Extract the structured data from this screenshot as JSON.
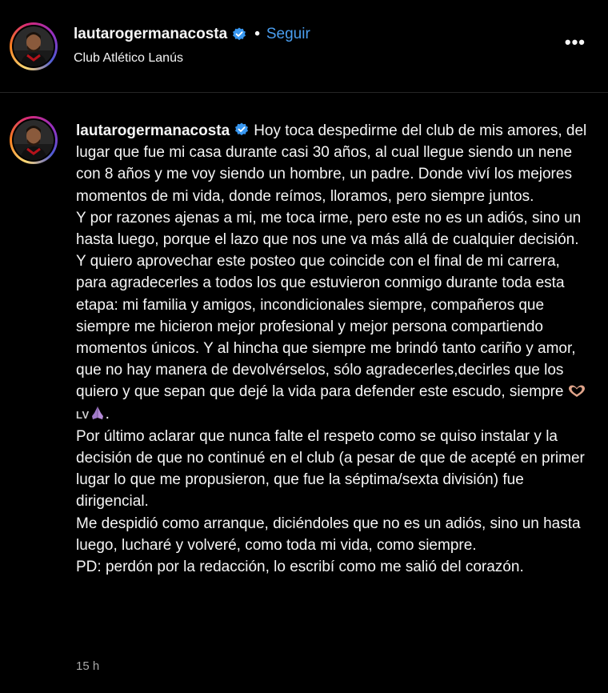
{
  "header": {
    "username": "lautarogermanacosta",
    "separator": "•",
    "follow_label": "Seguir",
    "location": "Club Atlético Lanús",
    "more_label": "•••"
  },
  "caption": {
    "username": "lautarogermanacosta",
    "paragraphs": [
      "Hoy toca despedirme del club de mis amores, del lugar que fue mi casa durante casi 30 años, al cual llegue siendo un nene con 8 años y me voy siendo un hombre, un padre. Donde viví los mejores momentos de mi vida, donde reímos, lloramos, pero siempre juntos.",
      "Y por razones ajenas a mi, me toca irme, pero este no es un adiós, sino un hasta luego, porque el lazo que nos une va más allá de cualquier decisión.",
      "Y quiero aprovechar este posteo que coincide con el final de mi carrera, para agradecerles a todos los que estuvieron conmigo durante toda esta etapa: mi familia y amigos, incondicionales siempre, compañeros que siempre me hicieron mejor profesional y mejor persona compartiendo momentos únicos. Y al hincha que siempre me brindó tanto cariño y amor, que no hay manera de devolvérselos, sólo agradecerles,decirles que los quiero y que sepan que dejé la vida para defender este escudo, siempre",
      "LV",
      ".",
      "Por último aclarar que nunca falte el respeto como se quiso instalar y la decisión de que no continué en el club (a pesar de que de acepté en primer lugar lo que me propusieron, que fue la séptima/sexta división) fue dirigencial.",
      "Me despidió como arranque, diciéndoles que no es un adiós, sino un hasta luego, lucharé y volveré, como toda mi vida, como siempre.",
      "PD: perdón por la redacción, lo escribí como me salió del corazón."
    ],
    "emojis": [
      "heart-hands-emoji",
      "praying-hands-emoji"
    ]
  },
  "timestamp": "15 h",
  "colors": {
    "background": "#000000",
    "text": "#f5f5f5",
    "follow": "#4a9ef0",
    "verified": "#3897f0",
    "muted": "#a8a8a8"
  }
}
